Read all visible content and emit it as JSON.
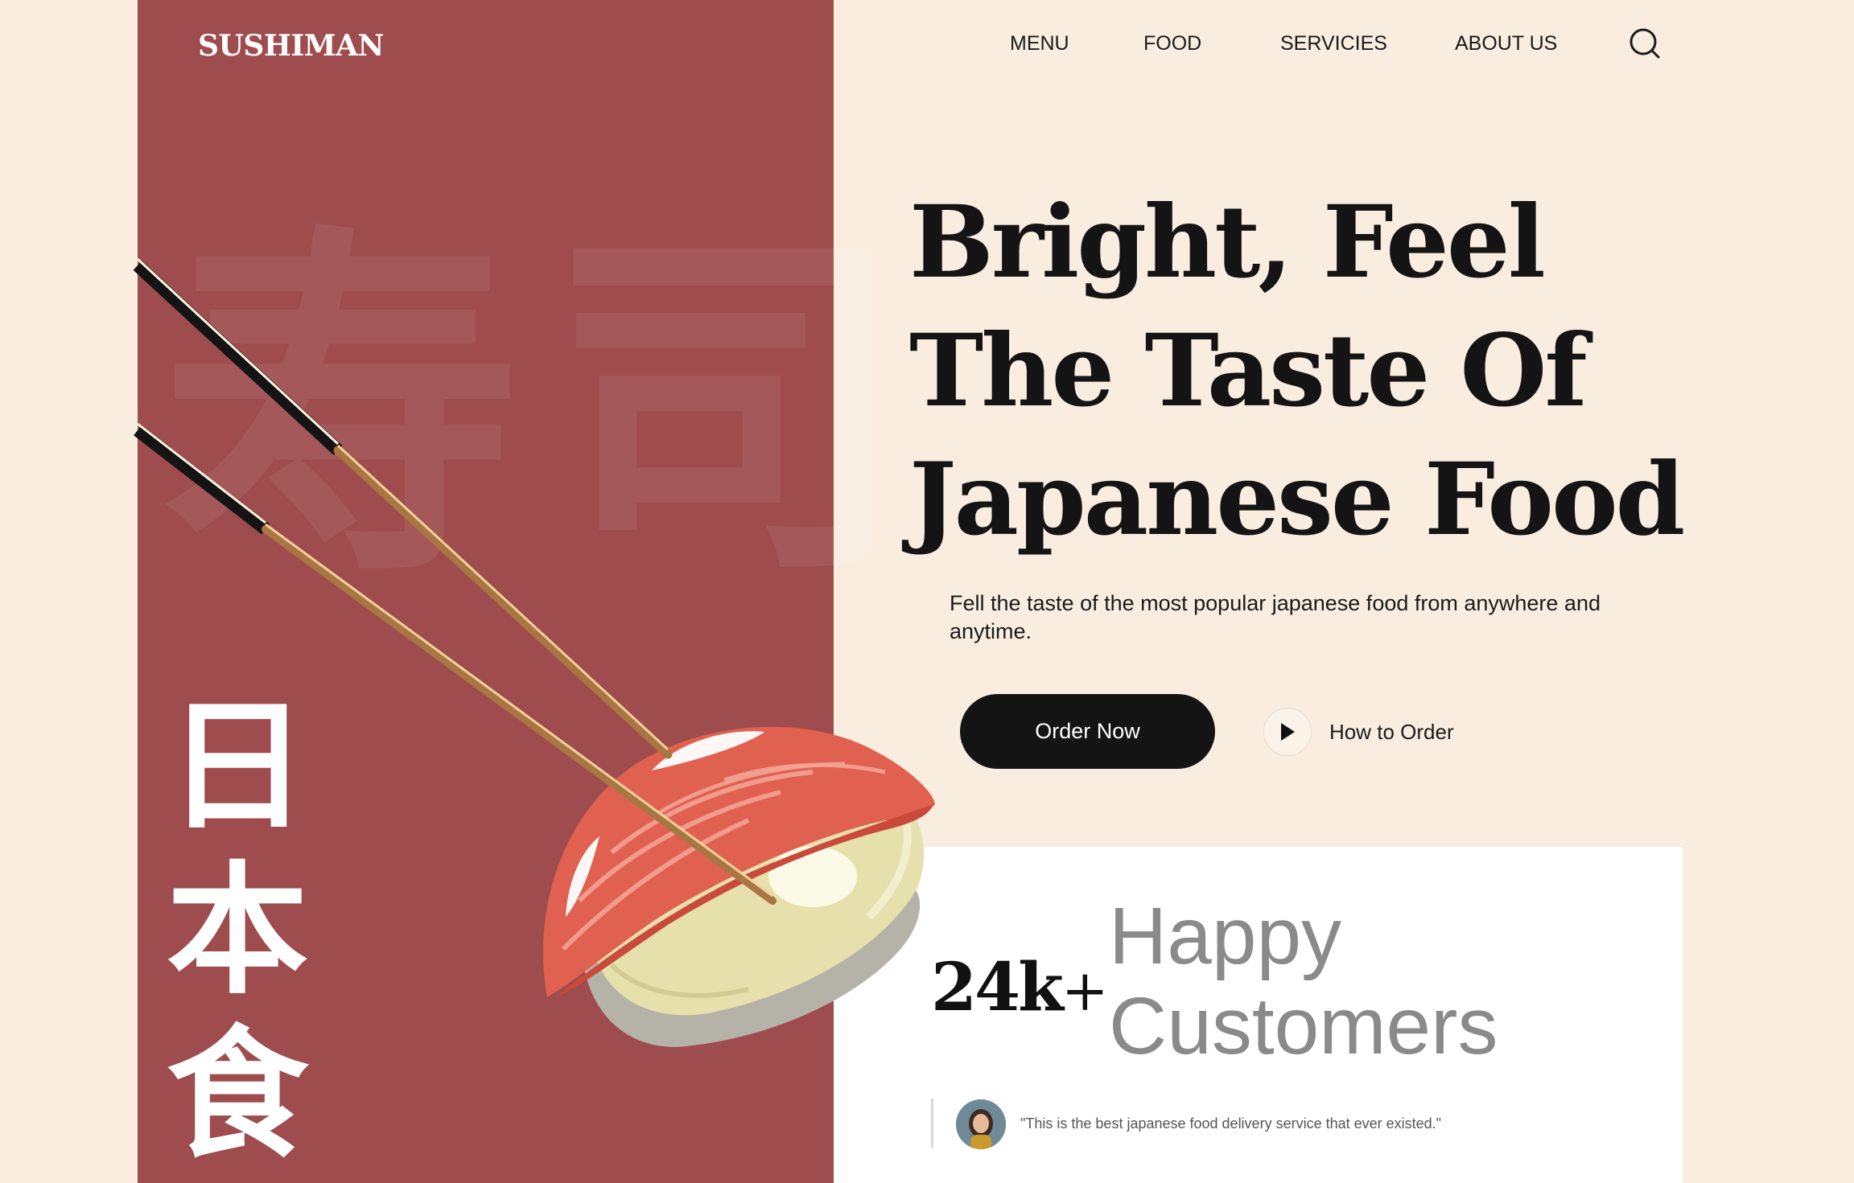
{
  "header": {
    "brand": "SUSHIMAN",
    "nav": [
      {
        "label": "MENU"
      },
      {
        "label": "FOOD"
      },
      {
        "label": "SERVICIES"
      },
      {
        "label": "ABOUT US"
      }
    ]
  },
  "hero": {
    "title_lines": [
      "Bright, Feel",
      "The Taste Of",
      "Japanese Food"
    ],
    "subtitle": "Fell the taste of the most popular japanese food from anywhere and anytime.",
    "order_button": "Order Now",
    "how_to_label": "How to Order"
  },
  "decor": {
    "vertical_kanji": [
      "日",
      "本",
      "食"
    ],
    "background_kanji": "寿司"
  },
  "stats": {
    "number": "24k",
    "plus": "+",
    "label_line1": "Happy",
    "label_line2": "Customers",
    "testimonial": "\"This is the best japanese food delivery service that ever existed.\""
  },
  "colors": {
    "background": "#f9ede0",
    "panel": "#9e4c4d",
    "button": "#141414",
    "card": "#ffffff"
  },
  "icons": {
    "search": "search-icon",
    "play": "play-icon"
  }
}
